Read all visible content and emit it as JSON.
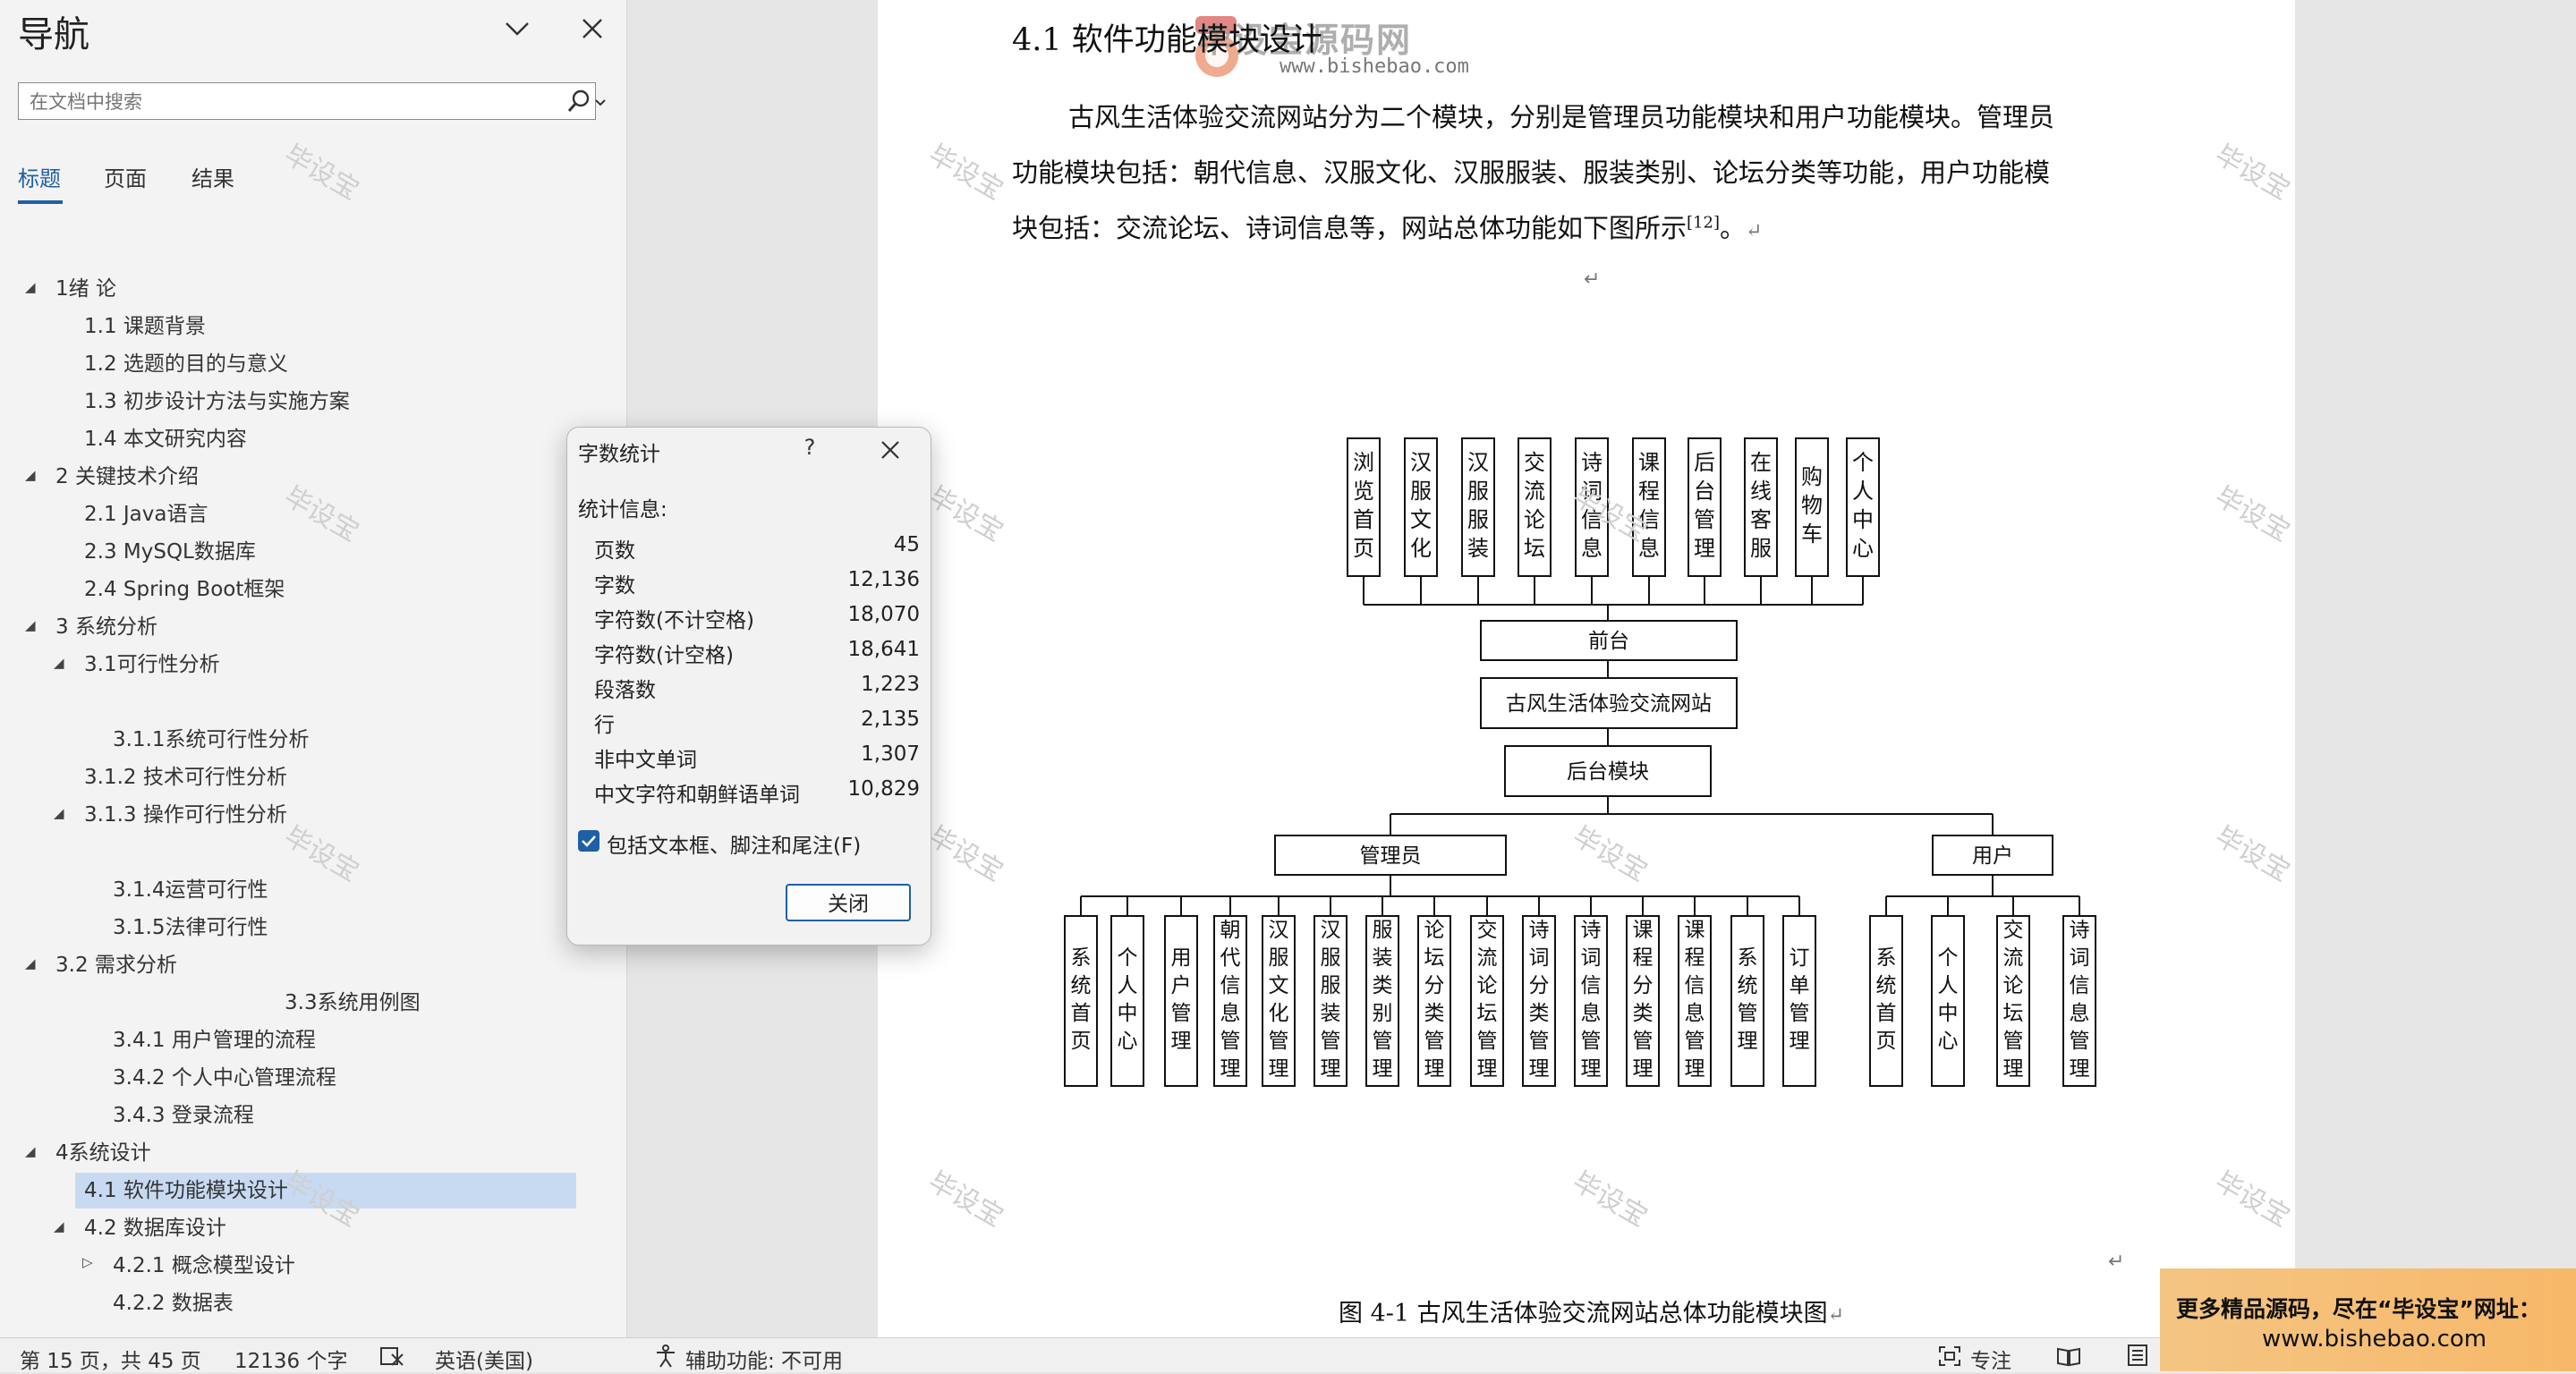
{
  "nav": {
    "title": "导航",
    "search_placeholder": "在文档中搜索",
    "tabs": [
      "标题",
      "页面",
      "结果"
    ],
    "tree": [
      "1绪 论",
      "1.1 课题背景",
      "1.2 选题的目的与意义",
      "1.3 初步设计方法与实施方案",
      "1.4 本文研究内容",
      "2 关键技术介绍",
      "2.1 Java语言",
      "2.3 MySQL数据库",
      "2.4 Spring Boot框架",
      "3 系统分析",
      "3.1可行性分析",
      "3.1.1系统可行性分析",
      "3.1.2 技术可行性分析",
      "3.1.3 操作可行性分析",
      "3.1.4运营可行性",
      "3.1.5法律可行性",
      "3.2 需求分析",
      "3.3系统用例图",
      "3.4.1 用户管理的流程",
      "3.4.2 个人中心管理流程",
      "3.4.3 登录流程",
      "4系统设计",
      "4.1 软件功能模块设计",
      "4.2 数据库设计",
      "4.2.1 概念模型设计",
      "4.2.2 数据表"
    ]
  },
  "doc": {
    "heading": "4.1  软件功能模块设计",
    "para_line1": "古风生活体验交流网站分为二个模块，分别是管理员功能模块和用户功能模块。管理员",
    "para_line2": "功能模块包括：朝代信息、汉服文化、汉服服装、服装类别、论坛分类等功能，用户功能模",
    "para_line3": "块包括：交流论坛、诗词信息等，网站总体功能如下图所示",
    "para_ref": "[12]",
    "para_end": "。",
    "return_mark": "↵",
    "figure_caption": "图 4-1 古风生活体验交流网站总体功能模块图",
    "watermark": "毕设宝",
    "logo_text": "毕设宝源码网",
    "logo_url": "www.bishebao.com"
  },
  "diagram": {
    "front_items": [
      "浏览首页",
      "汉服文化",
      "汉服服装",
      "交流论坛",
      "诗词信息",
      "课程信息",
      "后台管理",
      "在线客服",
      "购物车",
      "个人中心"
    ],
    "front": "前台",
    "site": "古风生活体验交流网站",
    "backend": "后台模块",
    "admin": "管理员",
    "user": "用户",
    "admin_items": [
      "系统首页",
      "个人中心",
      "用户管理",
      "朝代信息管理",
      "汉服文化管理",
      "汉服服装管理",
      "服装类别管理",
      "论坛分类管理",
      "交流论坛管理",
      "诗词分类管理",
      "诗词信息管理",
      "课程分类管理",
      "课程信息管理",
      "系统管理",
      "订单管理"
    ],
    "user_items": [
      "系统首页",
      "个人中心",
      "交流论坛管理",
      "诗词信息管理"
    ]
  },
  "dialog": {
    "title": "字数统计",
    "help": "?",
    "section": "统计信息:",
    "stats": [
      {
        "label": "页数",
        "value": "45"
      },
      {
        "label": "字数",
        "value": "12,136"
      },
      {
        "label": "字符数(不计空格)",
        "value": "18,070"
      },
      {
        "label": "字符数(计空格)",
        "value": "18,641"
      },
      {
        "label": "段落数",
        "value": "1,223"
      },
      {
        "label": "行",
        "value": "2,135"
      },
      {
        "label": "非中文单词",
        "value": "1,307"
      },
      {
        "label": "中文字符和朝鲜语单词",
        "value": "10,829"
      }
    ],
    "checkbox_label": "包括文本框、脚注和尾注(F)",
    "checkbox_checked": true,
    "close_button": "关闭"
  },
  "status": {
    "page": "第 15 页，共 45 页",
    "words": "12136 个字",
    "language": "英语(美国)",
    "accessibility": "辅助功能: 不可用",
    "focus": "专注"
  },
  "ad": {
    "line1": "更多精品源码，尽在“毕设宝”网址：",
    "line2": "www.bishebao.com"
  },
  "colors": {
    "accent": "#1f5fa6",
    "selected": "#c8daf2",
    "ad": "#f6bd72"
  }
}
